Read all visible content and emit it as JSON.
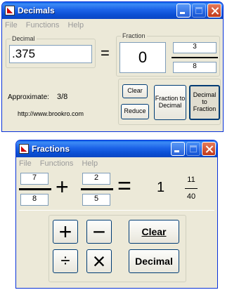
{
  "decimals_window": {
    "title": "Decimals",
    "menu": [
      "File",
      "Functions",
      "Help"
    ],
    "decimal_group_label": "Decimal",
    "decimal_value": ".375",
    "equals": "=",
    "fraction_group_label": "Fraction",
    "whole": "0",
    "numerator": "3",
    "denominator": "8",
    "approximate_label": "Approximate:",
    "approximate_value": "3/8",
    "url": "http://www.brookro.com",
    "buttons": {
      "clear": "Clear",
      "reduce": "Reduce",
      "fraction_to_decimal": "Fraction to Decimal",
      "decimal_to_fraction": "Decimal to Fraction"
    }
  },
  "fractions_window": {
    "title": "Fractions",
    "menu": [
      "File",
      "Functions",
      "Help"
    ],
    "fraction1": {
      "numerator": "7",
      "denominator": "8"
    },
    "operator": "+",
    "fraction2": {
      "numerator": "2",
      "denominator": "5"
    },
    "equals": "=",
    "result_whole": "1",
    "result_numerator": "11",
    "result_denominator": "40",
    "buttons": {
      "add": "+",
      "subtract": "−",
      "divide": "÷",
      "multiply": "×",
      "clear": "Clear",
      "decimal": "Decimal"
    }
  }
}
